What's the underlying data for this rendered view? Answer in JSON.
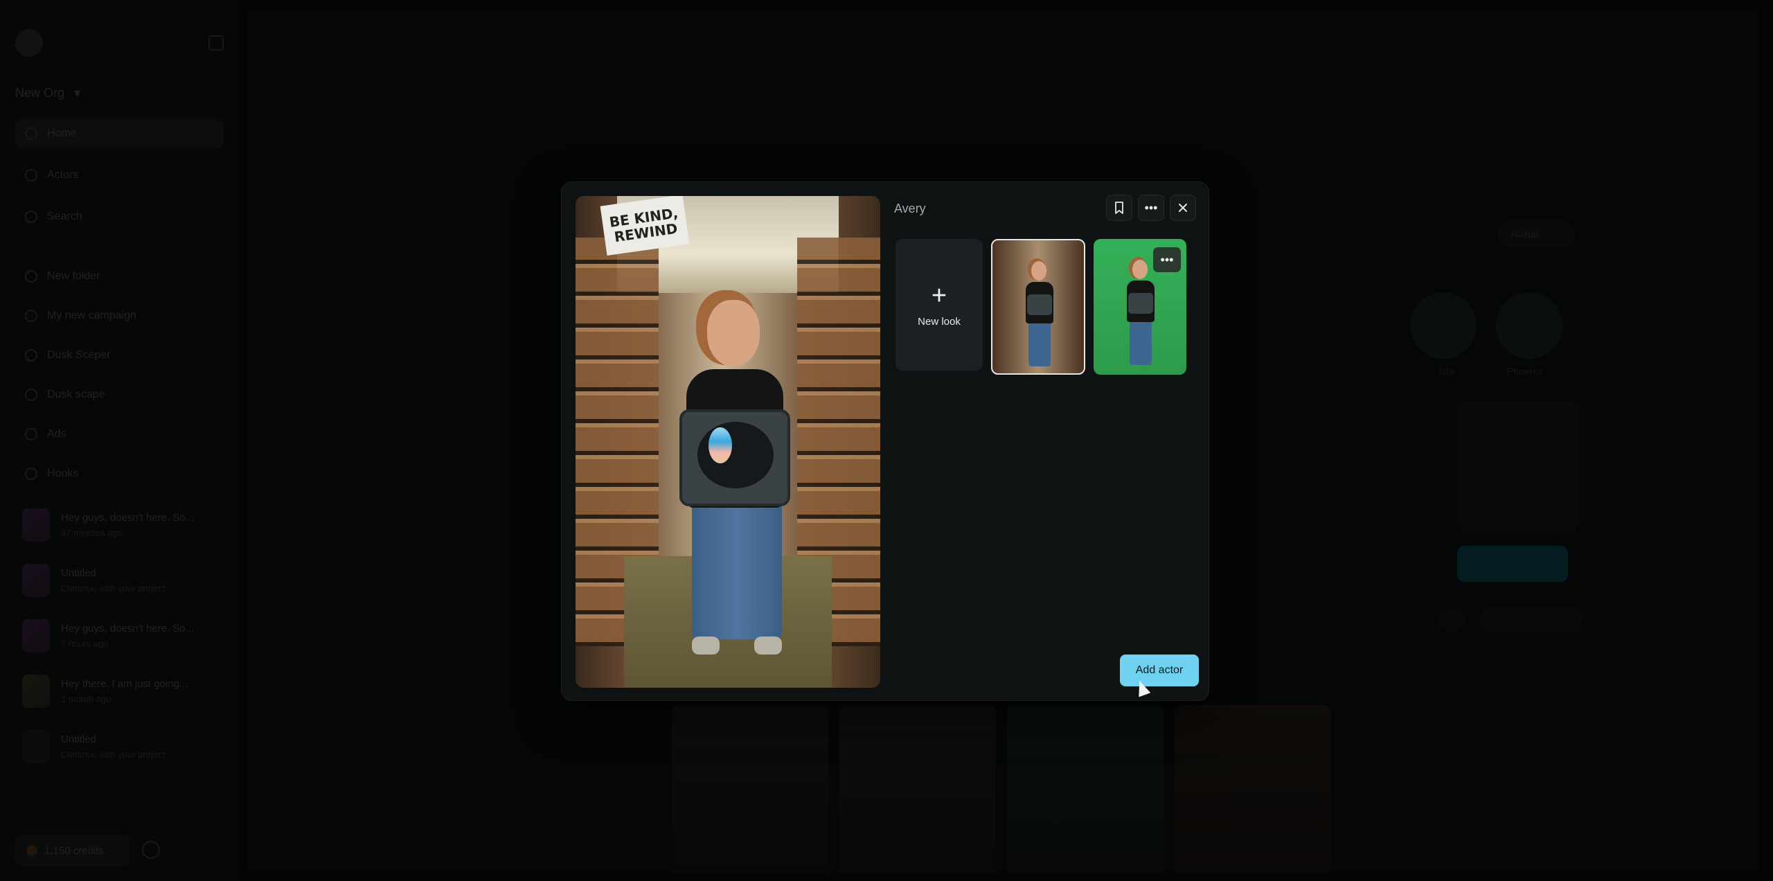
{
  "sidebar": {
    "org_name": "New Org",
    "nav": [
      {
        "label": "Home"
      },
      {
        "label": "Actors"
      },
      {
        "label": "Search"
      }
    ],
    "folders": [
      {
        "label": "New folder"
      },
      {
        "label": "My new campaign"
      },
      {
        "label": "Dusk Sceper"
      },
      {
        "label": "Dusk scape"
      },
      {
        "label": "Ads"
      },
      {
        "label": "Hooks"
      }
    ],
    "projects": [
      {
        "title": "Hey guys, doesn't here. So...",
        "meta": "47 minutes ago"
      },
      {
        "title": "Untitled",
        "meta": "Continue with your project"
      },
      {
        "title": "Hey guys, doesn't here. So...",
        "meta": "7 hours ago"
      },
      {
        "title": "Hey there, I am just going...",
        "meta": "1 month ago"
      },
      {
        "title": "Untitled",
        "meta": "Continue with your project"
      }
    ],
    "credits": "1,150 credits"
  },
  "background": {
    "avatar_pill": "Avatar",
    "circle_labels": [
      "Isla",
      "Phoenix"
    ]
  },
  "modal": {
    "actor_name": "Avery",
    "sign_text": "BE KIND, REWIND",
    "new_look_label": "New look",
    "add_actor_label": "Add actor",
    "icons": {
      "bookmark": "bookmark-icon",
      "more": "more-horizontal-icon",
      "close": "close-icon",
      "plus": "plus-icon"
    }
  },
  "colors": {
    "accent": "#6fd2f1",
    "modal_bg": "#0f1213",
    "page_bg": "#070808"
  }
}
